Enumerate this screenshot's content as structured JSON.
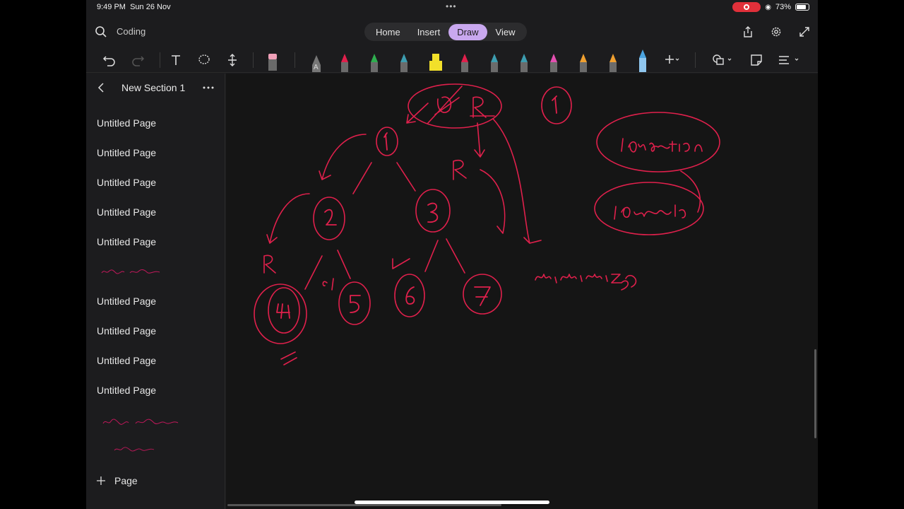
{
  "status": {
    "time": "9:49 PM",
    "date": "Sun 26 Nov",
    "battery": "73%"
  },
  "toolbar": {
    "notebook": "Coding",
    "tabs": [
      "Home",
      "Insert",
      "Draw",
      "View"
    ],
    "active_tab": "Draw"
  },
  "tools": {
    "pen_colors": [
      "#e0204c",
      "#2fae4f",
      "#3d9db0",
      "#f2e02a",
      "#e0204c",
      "#3d9db0",
      "#3d9db0",
      "#e34fb0",
      "#f0a030",
      "#f0a030",
      "#4aa3e0"
    ],
    "icons": [
      "undo-icon",
      "redo-icon",
      "type-icon",
      "lasso-icon",
      "insert-space-icon",
      "eraser-icon",
      "add-pen-icon",
      "shapes-icon",
      "ink-to-shape-icon",
      "ruler-options-icon"
    ]
  },
  "sidebar": {
    "section_title": "New Section 1",
    "pages": [
      "Untitled Page",
      "Untitled Page",
      "Untitled Page",
      "Untitled Page",
      "Untitled Page",
      "Untitled Page",
      "Untitled Page",
      "Untitled Page",
      "Untitled Page"
    ],
    "add_page_label": "Page"
  },
  "canvas": {
    "tree_nodes": [
      "1",
      "2",
      "3",
      "4",
      "5",
      "6",
      "7"
    ],
    "notes": [
      "1",
      "1 operation",
      "1 operation",
      "minimize"
    ],
    "ink_color": "#e0204c"
  }
}
